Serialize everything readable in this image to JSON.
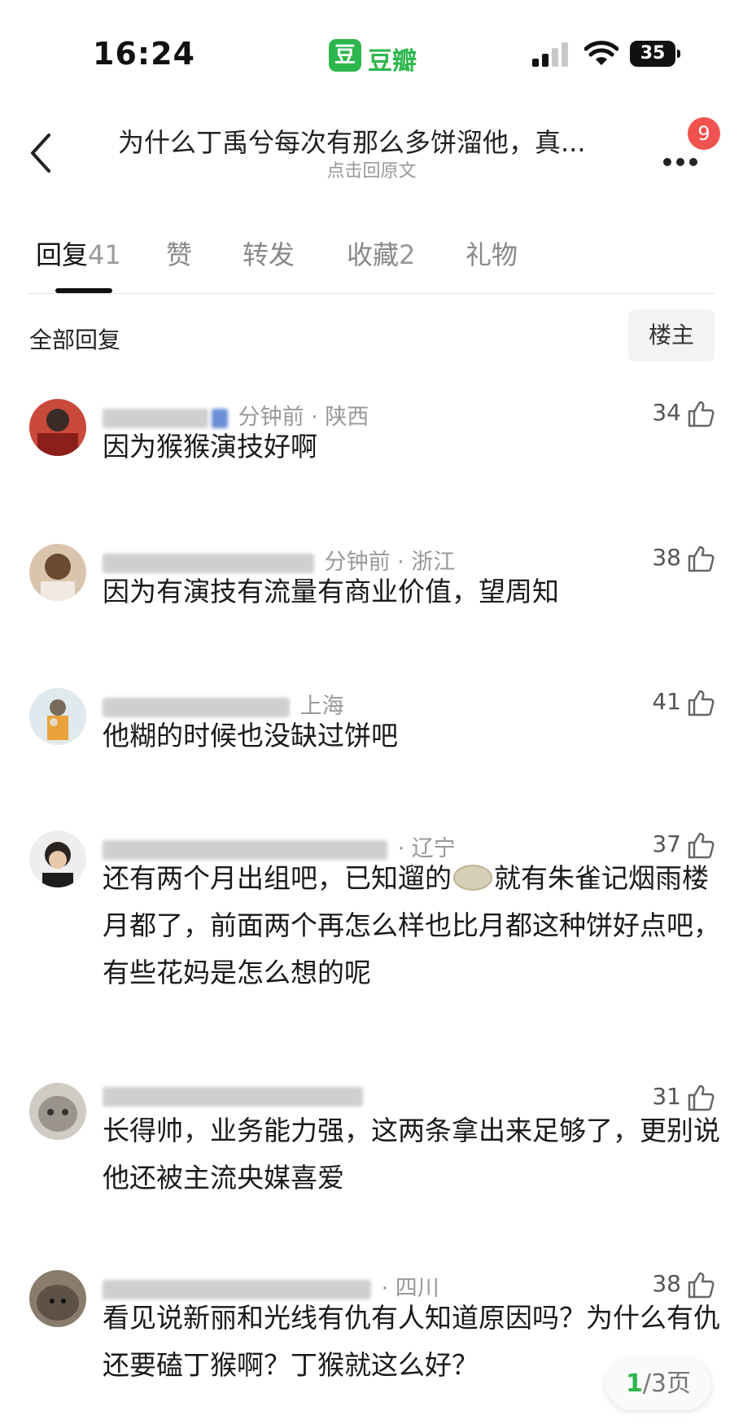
{
  "status_bar": {
    "time": "16:24",
    "app_logo": "豆",
    "app_name": "豆瓣",
    "battery": "35"
  },
  "nav": {
    "title": "为什么丁禹兮每次有那么多饼溜他，真...",
    "subtitle": "点击回原文",
    "badge": "9"
  },
  "tabs": [
    {
      "label": "回复",
      "count": "41"
    },
    {
      "label": "赞",
      "count": ""
    },
    {
      "label": "转发",
      "count": ""
    },
    {
      "label": "收藏",
      "count": "2"
    },
    {
      "label": "礼物",
      "count": ""
    }
  ],
  "filter": {
    "label": "全部回复",
    "owner_button": "楼主"
  },
  "comments": [
    {
      "meta": "分钟前 · 陕西",
      "likes": "34",
      "text": "因为猴猴演技好啊"
    },
    {
      "meta": "分钟前 · 浙江",
      "likes": "38",
      "text": "因为有演技有流量有商业价值，望周知"
    },
    {
      "meta": "上海",
      "likes": "41",
      "text": "他糊的时候也没缺过饼吧"
    },
    {
      "meta": "· 辽宁",
      "likes": "37",
      "text_before": "还有两个月出组吧，已知遛的",
      "text_after": "就有朱雀记烟雨楼月都了，前面两个再怎么样也比月都这种饼好点吧，有些花妈是怎么想的呢"
    },
    {
      "meta": "",
      "likes": "31",
      "text": "长得帅，业务能力强，这两条拿出来足够了，更别说他还被主流央媒喜爱"
    },
    {
      "meta": "· 四川",
      "likes": "38",
      "text": "看见说新丽和光线有仇有人知道原因吗？为什么有仇还要磕丁猴啊？丁猴就这么好？"
    }
  ],
  "pager": {
    "current": "1",
    "total": "/3页"
  },
  "colors": {
    "brand": "#2db64d",
    "badge": "#f2524f"
  }
}
